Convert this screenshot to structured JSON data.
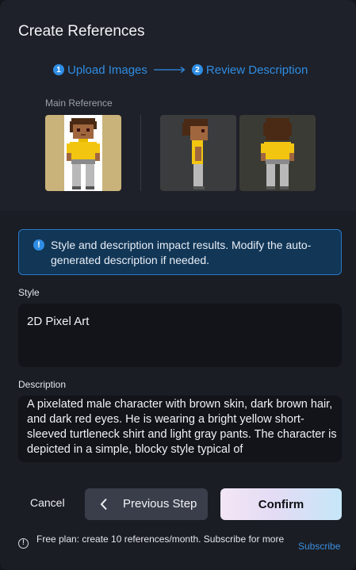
{
  "dialog": {
    "title": "Create References"
  },
  "steps": [
    {
      "number": "1",
      "label": "Upload Images"
    },
    {
      "number": "2",
      "label": "Review Description"
    }
  ],
  "references": {
    "main_label": "Main Reference"
  },
  "info_banner": {
    "icon": "info-icon",
    "text": "Style and description impact results. Modify the auto-generated description if needed."
  },
  "style": {
    "label": "Style",
    "value": "2D Pixel Art"
  },
  "description": {
    "label": "Description",
    "value": "A pixelated male character with brown skin, dark brown hair, and dark red eyes. He is wearing a bright yellow short-sleeved turtleneck shirt and light gray pants. The character is depicted in a simple, blocky style typical of"
  },
  "actions": {
    "cancel_label": "Cancel",
    "previous_label": "Previous Step",
    "confirm_label": "Confirm"
  },
  "footer": {
    "plan_text": "Free plan: create 10 references/month. Subscribe for more",
    "subscribe_label": "Subscribe"
  },
  "colors": {
    "accent": "#2f8de4",
    "background": "#1c1f27",
    "input_background": "#12141a"
  }
}
